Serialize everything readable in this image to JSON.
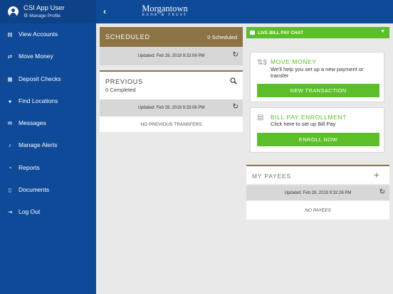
{
  "user": {
    "name": "CSI App User",
    "manage_label": "Manage Profile"
  },
  "nav": [
    {
      "label": "View Accounts",
      "icon": "accounts-icon"
    },
    {
      "label": "Move Money",
      "icon": "move-money-icon"
    },
    {
      "label": "Deposit Checks",
      "icon": "deposit-icon"
    },
    {
      "label": "Find Locations",
      "icon": "location-icon"
    },
    {
      "label": "Messages",
      "icon": "mail-icon"
    },
    {
      "label": "Manage Alerts",
      "icon": "bell-icon"
    },
    {
      "label": "Reports",
      "icon": "pie-chart-icon"
    },
    {
      "label": "Documents",
      "icon": "document-icon"
    },
    {
      "label": "Log Out",
      "icon": "logout-icon"
    }
  ],
  "header": {
    "logo_line1": "Morgantown",
    "logo_line2": "BANK & TRUST"
  },
  "scheduled": {
    "title": "SCHEDULED",
    "count": "0 Scheduled",
    "updated": "Updated: Feb 28, 2019 9:33:06 PM"
  },
  "previous": {
    "title": "PREVIOUS",
    "count": "0 Completed",
    "updated": "Updated: Feb 28, 2019 9:33:06 PM",
    "empty": "NO PREVIOUS TRANSFERS"
  },
  "chat": {
    "label": "LIVE BILL PAY CHAT"
  },
  "move_money": {
    "title": "MOVE MONEY",
    "desc": "We'll help you set up a new payment or transfer",
    "button": "NEW TRANSACTION"
  },
  "enroll": {
    "title": "BILL PAY ENROLLMENT",
    "desc": "Click here to set up Bill Pay",
    "button": "ENROLL NOW"
  },
  "payees": {
    "title": "MY PAYEES",
    "updated": "Updated: Feb 28, 2019 9:32:26 PM",
    "empty": "NO PAYEES"
  },
  "colors": {
    "sidebar": "#0f4a99",
    "gold": "#8c7447",
    "green": "#5cbf2a"
  }
}
